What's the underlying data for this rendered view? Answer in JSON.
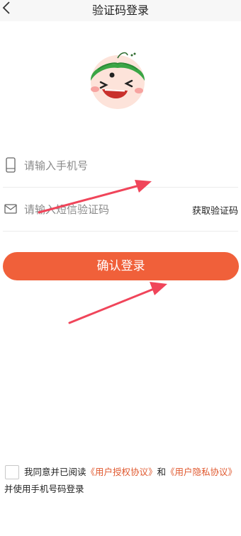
{
  "header": {
    "title": "验证码登录",
    "back_icon": "chevron-left-icon"
  },
  "mascot": {
    "icon": "watermelon-mascot-illustration"
  },
  "form": {
    "phone": {
      "icon": "phone-icon",
      "placeholder": "请输入手机号",
      "value": ""
    },
    "code": {
      "icon": "envelope-icon",
      "placeholder": "请输入短信验证码",
      "value": "",
      "get_code_label": "获取验证码"
    },
    "submit_label": "确认登录"
  },
  "agreement": {
    "checked": false,
    "prefix": "我同意并已阅读",
    "user_auth_link": "《用户授权协议》",
    "and": "和",
    "privacy_link": "《用户隐私协议》",
    "suffix": "并使用手机号码登录"
  },
  "colors": {
    "accent": "#f0603a",
    "link": "#e0592f",
    "annotation_arrow": "#f0455a"
  }
}
